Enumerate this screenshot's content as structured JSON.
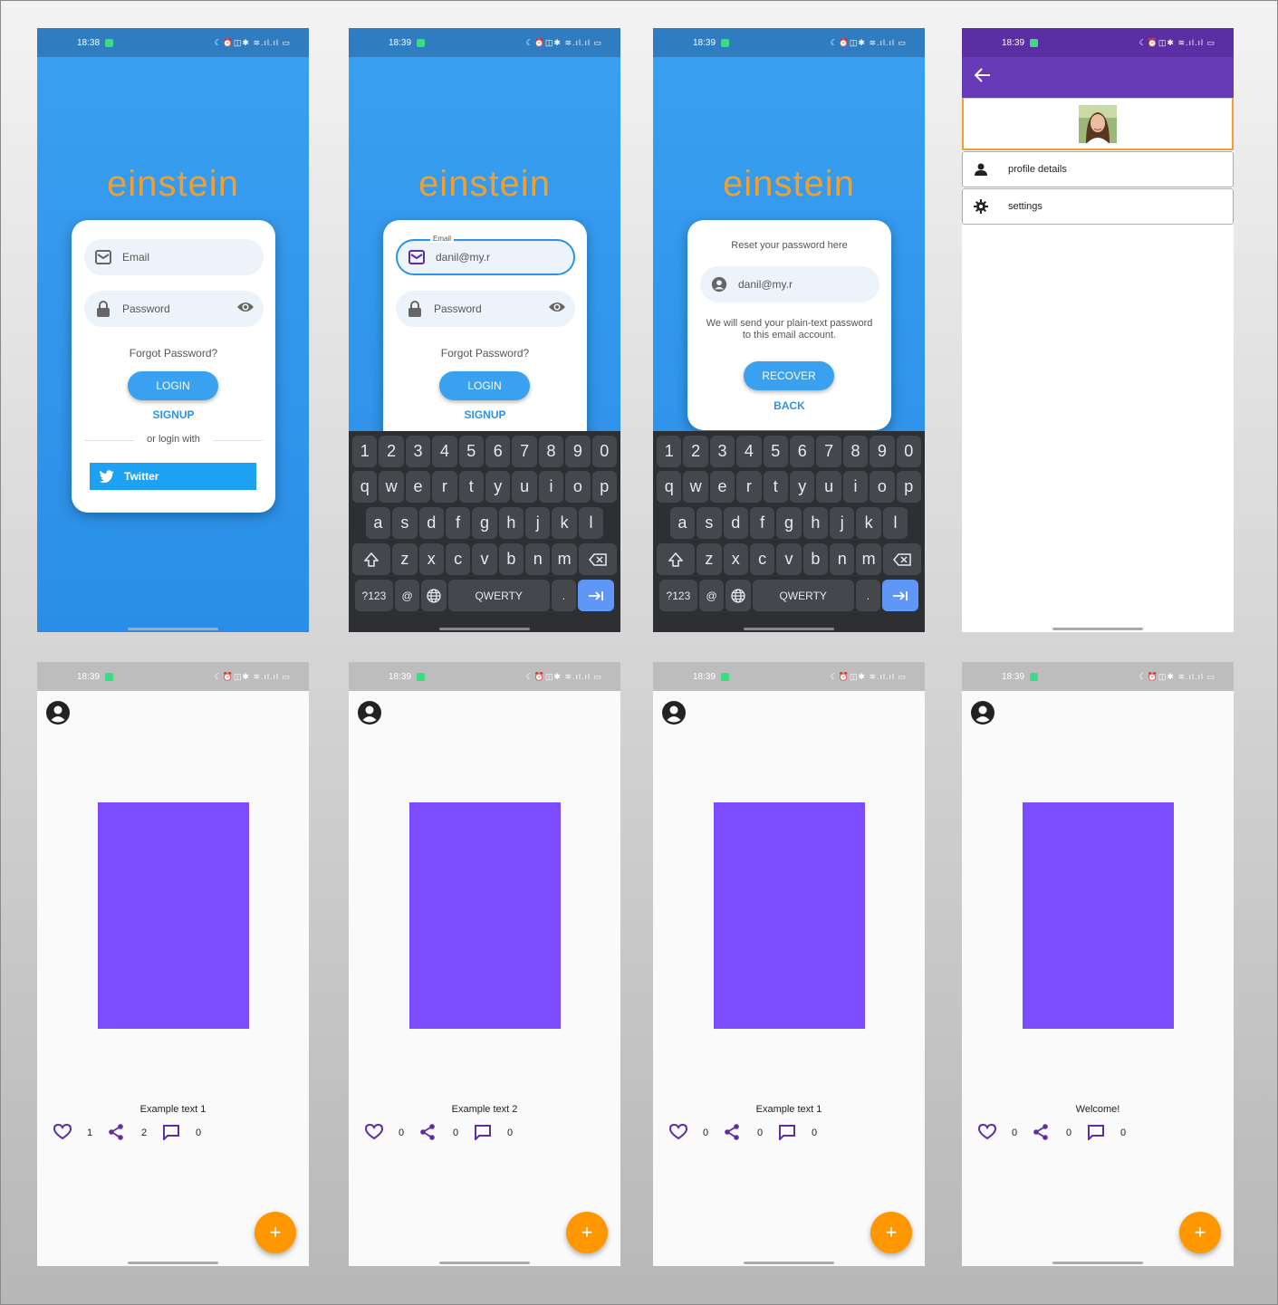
{
  "status": {
    "time1": "18:38",
    "time2": "18:39",
    "icons": "☾⏰◫✱ ≋.ıl.ıl ▭"
  },
  "app": {
    "logo": "einstein"
  },
  "login": {
    "email_placeholder": "Email",
    "email_label": "Email",
    "email_value": "danil@my.r",
    "password_placeholder": "Password",
    "forgot": "Forgot Password?",
    "login_button": "LOGIN",
    "signup_link": "SIGNUP",
    "or_login_with": "or login with",
    "twitter_button": "Twitter"
  },
  "reset": {
    "title": "Reset your password here",
    "email_value": "danil@my.r",
    "hint_line1": "We will send your plain-text password",
    "hint_line2": "to this email account.",
    "recover_button": "RECOVER",
    "back_link": "BACK"
  },
  "keyboard": {
    "numbers": [
      "1",
      "2",
      "3",
      "4",
      "5",
      "6",
      "7",
      "8",
      "9",
      "0"
    ],
    "row1": [
      "q",
      "w",
      "e",
      "r",
      "t",
      "y",
      "u",
      "i",
      "o",
      "p"
    ],
    "row2": [
      "a",
      "s",
      "d",
      "f",
      "g",
      "h",
      "j",
      "k",
      "l"
    ],
    "row3": [
      "z",
      "x",
      "c",
      "v",
      "b",
      "n",
      "m"
    ],
    "sym": "?123",
    "at": "@",
    "space": "QWERTY",
    "dot": "."
  },
  "menu": {
    "items": [
      {
        "label": "profile details",
        "icon": "person-icon"
      },
      {
        "label": "settings",
        "icon": "gear-icon"
      }
    ]
  },
  "feeds": [
    {
      "text": "Example text 1",
      "likes": "1",
      "shares": "2",
      "comments": "0"
    },
    {
      "text": "Example text 2",
      "likes": "0",
      "shares": "0",
      "comments": "0"
    },
    {
      "text": "Example text 1",
      "likes": "0",
      "shares": "0",
      "comments": "0"
    },
    {
      "text": "Welcome!",
      "likes": "0",
      "shares": "0",
      "comments": "0"
    }
  ],
  "fab_label": "+",
  "colors": {
    "primary_blue": "#3aa0f0",
    "logo_orange": "#f0a030",
    "purple": "#673ab7",
    "card_purple": "#7c4dff",
    "fab_orange": "#ff9800",
    "twitter": "#1da1f2"
  }
}
